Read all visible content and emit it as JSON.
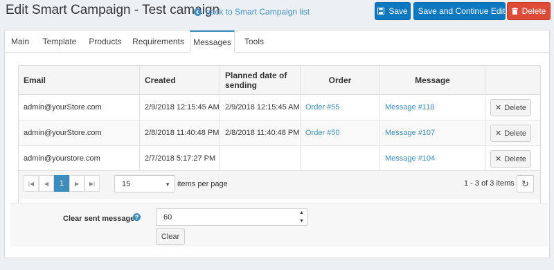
{
  "header": {
    "title": "Edit Smart Campaign - Test camaign",
    "back_link": "back to Smart Campaign list",
    "save_label": "Save",
    "save_continue_label": "Save and Continue Edit",
    "delete_label": "Delete"
  },
  "tabs": [
    {
      "label": "Main",
      "active": false
    },
    {
      "label": "Template",
      "active": false
    },
    {
      "label": "Products",
      "active": false
    },
    {
      "label": "Requirements",
      "active": false
    },
    {
      "label": "Messages",
      "active": true
    },
    {
      "label": "Tools",
      "active": false
    }
  ],
  "grid": {
    "columns": [
      "Email",
      "Created",
      "Planned date of sending",
      "Order",
      "Message",
      ""
    ],
    "rows": [
      {
        "email": "admin@yourStore.com",
        "created": "2/9/2018 12:15:45 AM",
        "planned": "2/9/2018 12:15:45 AM",
        "order": "Order #55",
        "message": "Message #118",
        "action": "Delete"
      },
      {
        "email": "admin@yourStore.com",
        "created": "2/8/2018 11:40:48 PM",
        "planned": "2/8/2018 11:40:48 PM",
        "order": "Order #50",
        "message": "Message #107",
        "action": "Delete"
      },
      {
        "email": "admin@yourstore.com",
        "created": "2/7/2018 5:17:27 PM",
        "planned": "",
        "order": "",
        "message": "Message #104",
        "action": "Delete"
      }
    ]
  },
  "pager": {
    "current_page": "1",
    "page_size": "15",
    "items_per_page_label": "items per page",
    "items_info": "1 - 3 of 3 items"
  },
  "clear_sent": {
    "label": "Clear sent messages",
    "value": "60",
    "button_label": "Clear"
  },
  "colors": {
    "primary": "#0b78bf",
    "danger": "#dd4b39",
    "link": "#3c8dbc"
  }
}
